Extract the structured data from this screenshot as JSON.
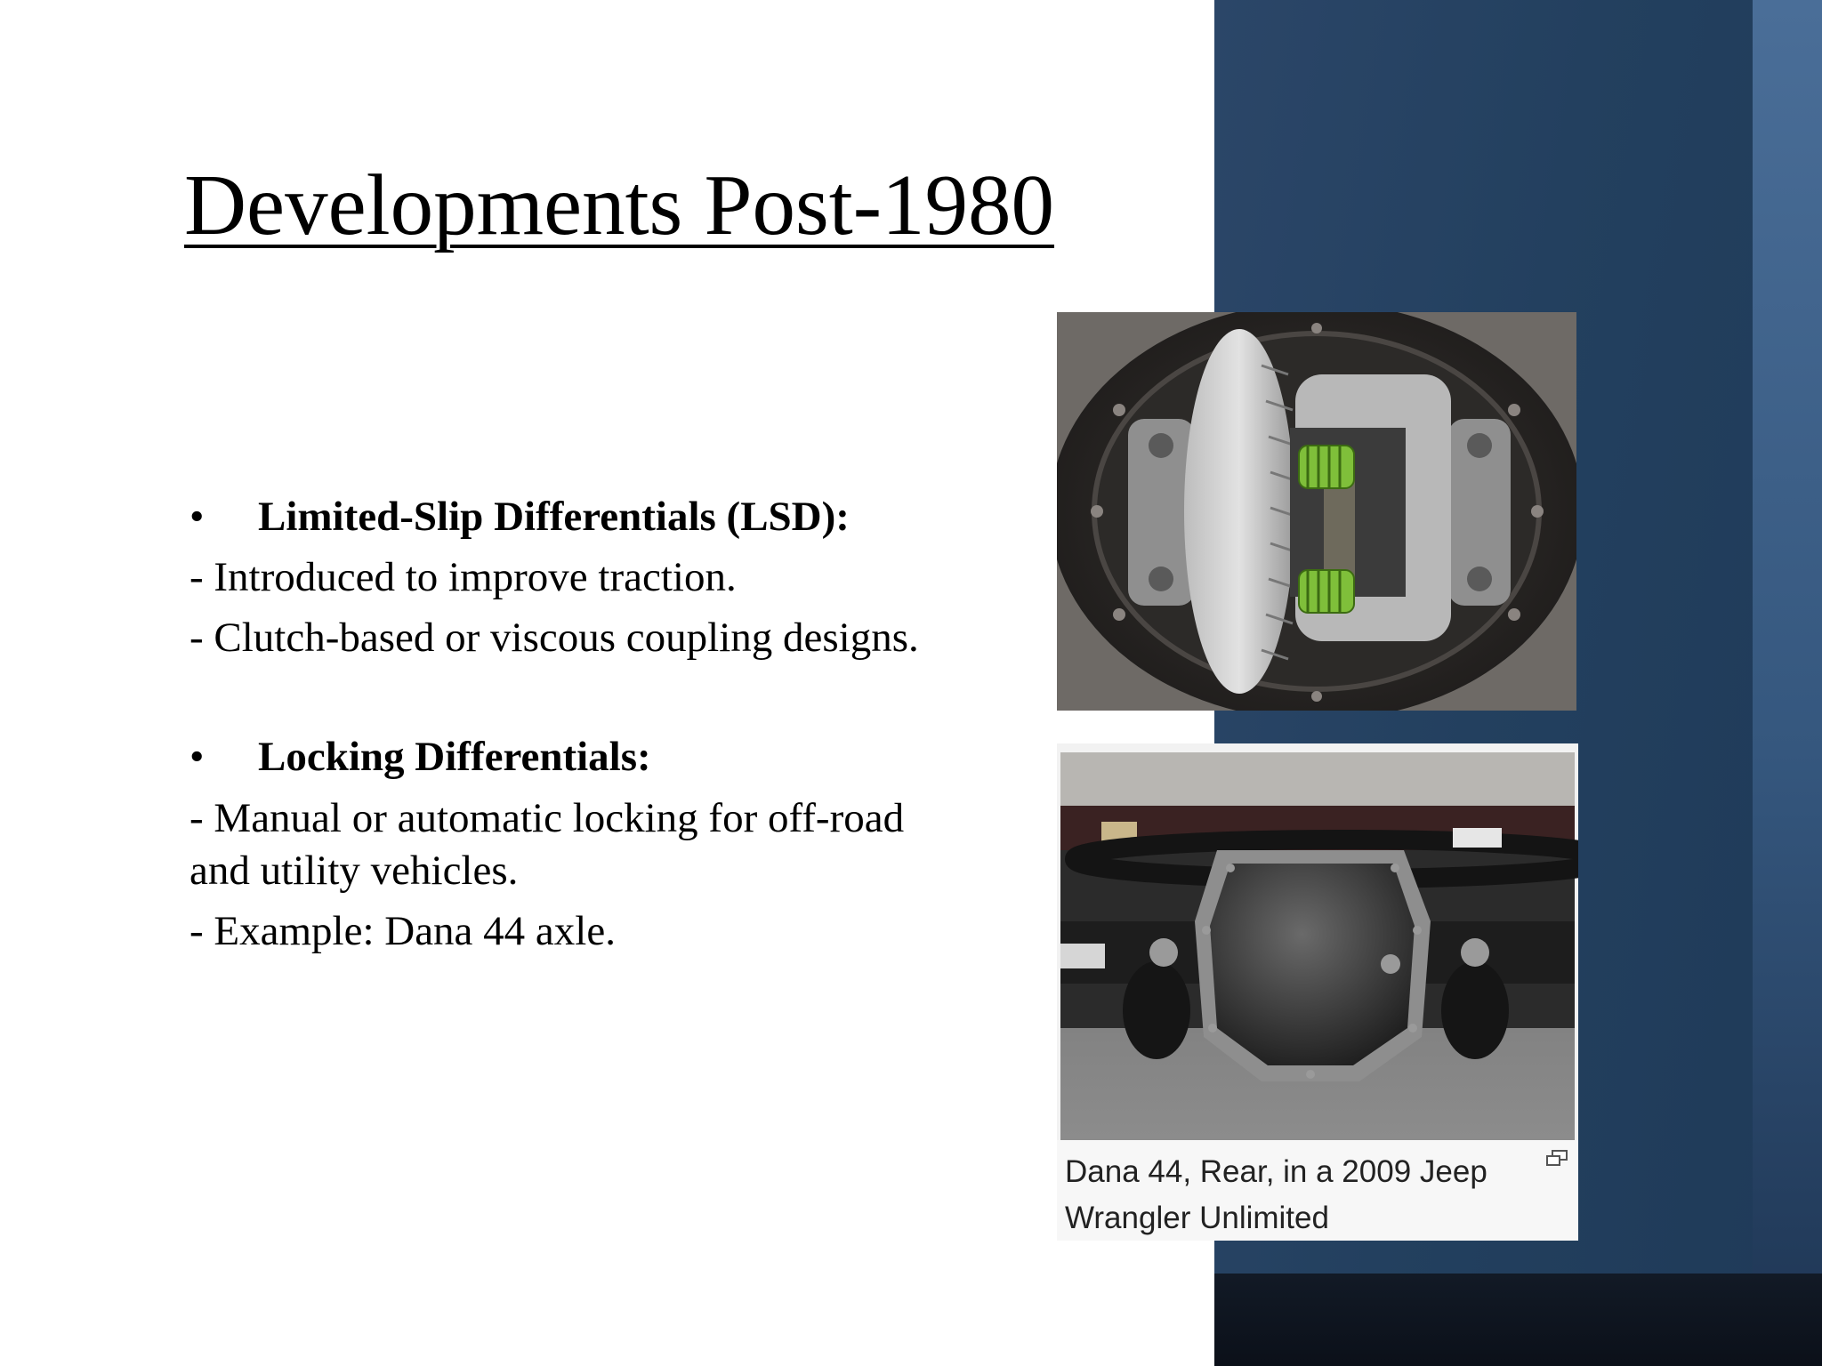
{
  "slide": {
    "title": "Developments Post-1980",
    "sections": [
      {
        "bullet": "•",
        "heading": "Limited-Slip Differentials (LSD):",
        "lines": [
          "- Introduced to improve traction.",
          "- Clutch-based or viscous coupling designs."
        ]
      },
      {
        "bullet": "•",
        "heading": "Locking Differentials:",
        "lines": [
          "- Manual or automatic locking for off-road",
          "and utility vehicles.",
          "- Example: Dana 44 axle."
        ]
      }
    ]
  },
  "images": {
    "top": {
      "subject": "limited-slip differential interior"
    },
    "bottom": {
      "subject": "Dana 44 rear axle",
      "caption_lines": [
        "Dana 44, Rear, in a 2009 Jeep",
        "Wrangler Unlimited"
      ],
      "icon": "enlarge-icon"
    }
  },
  "colors": {
    "side_panel": "#23405f",
    "stripe": "#3d6189",
    "bottom_band": "#0e1520"
  }
}
